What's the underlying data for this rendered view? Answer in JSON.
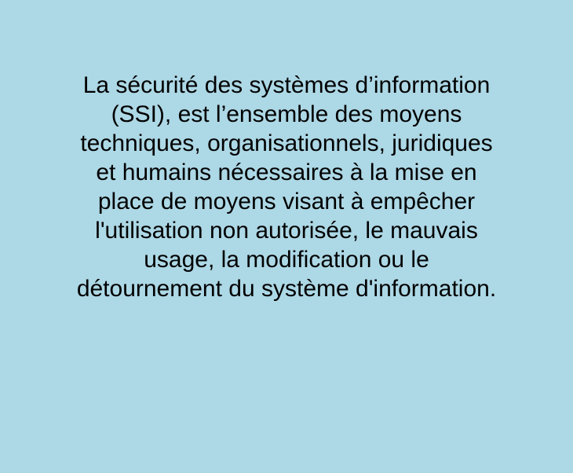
{
  "slide": {
    "background_color": "#add8e6",
    "text_color": "#000000",
    "definition_lines": [
      "La sécurité des systèmes d’information",
      "(SSI), est l’ensemble des moyens",
      "techniques, organisationnels, juridiques",
      "et humains nécessaires à la mise en",
      "place de moyens visant à empêcher",
      "l'utilisation non autorisée, le mauvais",
      "usage, la modification ou le",
      "détournement du système d'information."
    ]
  }
}
